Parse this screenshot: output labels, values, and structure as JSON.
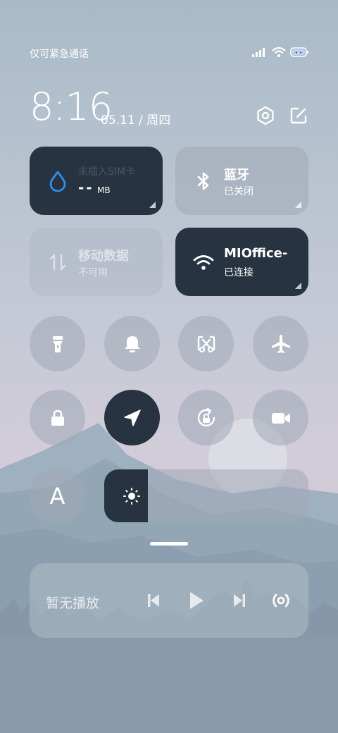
{
  "status_bar": {
    "carrier": "仅可紧急通话",
    "battery": "[ ]"
  },
  "header": {
    "time": "8:16",
    "date": "05.11 / 周四"
  },
  "tiles": {
    "data_usage": {
      "title": "未插入SIM卡",
      "value": "- -",
      "unit": "MB"
    },
    "bluetooth": {
      "title": "蓝牙",
      "status": "已关闭"
    },
    "mobile_data": {
      "title": "移动数据",
      "status": "不可用"
    },
    "wifi": {
      "title": "MIOffice-",
      "status": "已连接"
    }
  },
  "toggles": [
    {
      "name": "flashlight",
      "active": false
    },
    {
      "name": "bell",
      "active": false
    },
    {
      "name": "screenshot",
      "active": false
    },
    {
      "name": "airplane",
      "active": false
    },
    {
      "name": "lock",
      "active": false
    },
    {
      "name": "location",
      "active": true
    },
    {
      "name": "rotation-lock",
      "active": false
    },
    {
      "name": "screen-record",
      "active": false
    },
    {
      "name": "auto-text",
      "label": "A",
      "active": false
    }
  ],
  "brightness": {
    "level": 0.215
  },
  "media": {
    "status": "暂无播放"
  },
  "colors": {
    "dark_tile": "#273340",
    "accent_blue": "#2f8fe6"
  }
}
